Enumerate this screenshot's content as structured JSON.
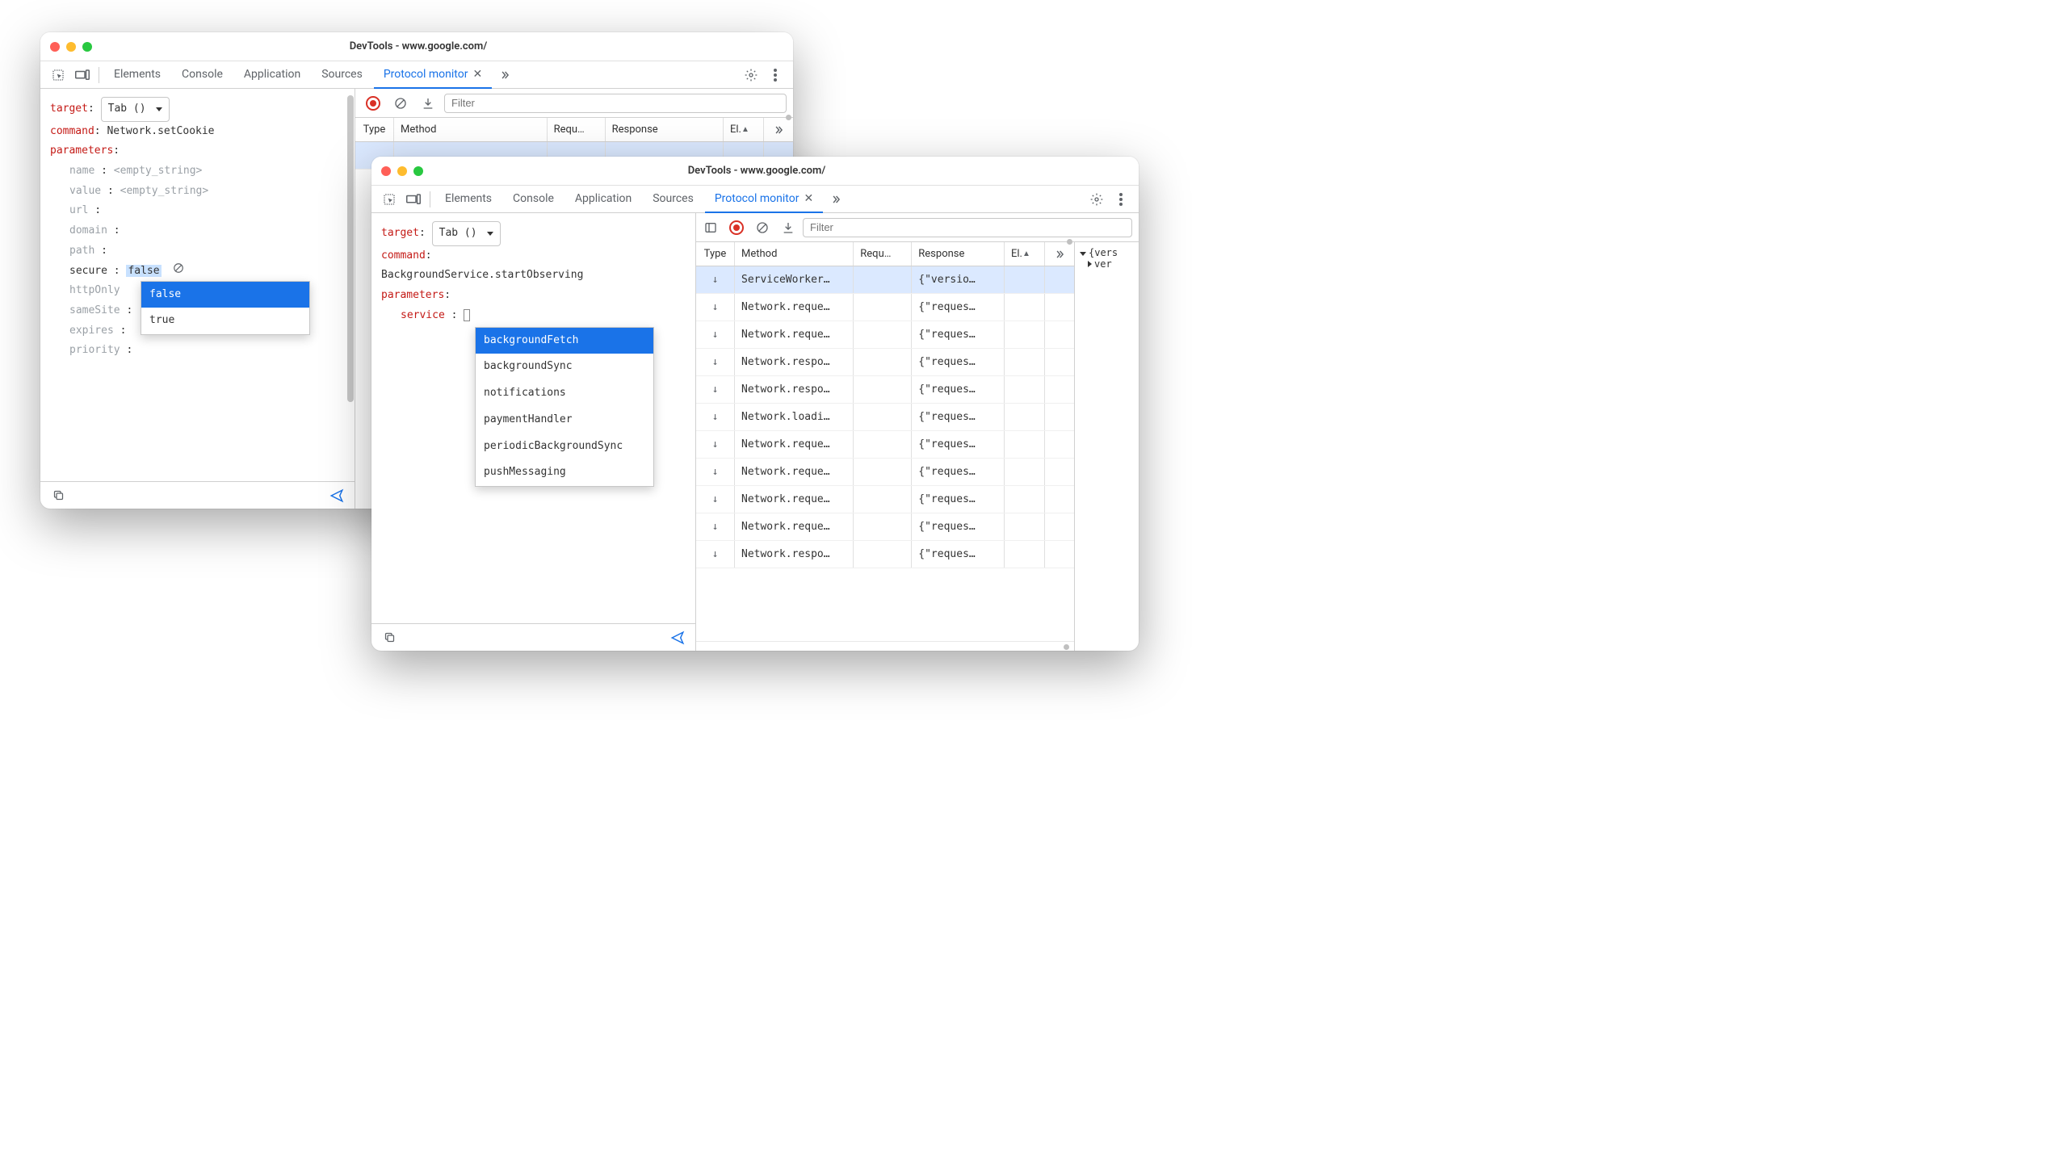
{
  "window1": {
    "title": "DevTools - www.google.com/",
    "tabs": [
      "Elements",
      "Console",
      "Application",
      "Sources",
      "Protocol monitor"
    ],
    "active_tab": "Protocol monitor",
    "target_label": "target",
    "target_select": "Tab ()",
    "command_label": "command",
    "command_value": "Network.setCookie",
    "parameters_label": "parameters",
    "params": {
      "name": {
        "k": "name",
        "v": "<empty_string>"
      },
      "value": {
        "k": "value",
        "v": "<empty_string>"
      },
      "url": {
        "k": "url",
        "v": ""
      },
      "domain": {
        "k": "domain",
        "v": ""
      },
      "path": {
        "k": "path",
        "v": ""
      },
      "secure": {
        "k": "secure",
        "v": "false"
      },
      "httpOnly": {
        "k": "httpOnly",
        "v": ""
      },
      "sameSite": {
        "k": "sameSite",
        "v": ""
      },
      "expires": {
        "k": "expires",
        "v": ""
      },
      "priority": {
        "k": "priority",
        "v": ""
      }
    },
    "bool_dropdown": [
      "false",
      "true"
    ],
    "right_cols": {
      "type": "Type",
      "method": "Method",
      "req": "Requ…",
      "resp": "Response",
      "el": "El.",
      "sort": "▲"
    },
    "filter_placeholder": "Filter"
  },
  "window2": {
    "title": "DevTools - www.google.com/",
    "tabs": [
      "Elements",
      "Console",
      "Application",
      "Sources",
      "Protocol monitor"
    ],
    "active_tab": "Protocol monitor",
    "target_label": "target",
    "target_select": "Tab ()",
    "command_label": "command",
    "command_value": "BackgroundService.startObserving",
    "parameters_label": "parameters",
    "service_label": "service",
    "service_dropdown": [
      "backgroundFetch",
      "backgroundSync",
      "notifications",
      "paymentHandler",
      "periodicBackgroundSync",
      "pushMessaging"
    ],
    "filter_placeholder": "Filter",
    "right_cols": {
      "type": "Type",
      "method": "Method",
      "req": "Requ…",
      "resp": "Response",
      "el": "El.",
      "sort": "▲"
    },
    "rows": [
      {
        "method": "ServiceWorker…",
        "resp": "{\"versio…"
      },
      {
        "method": "Network.reque…",
        "resp": "{\"reques…"
      },
      {
        "method": "Network.reque…",
        "resp": "{\"reques…"
      },
      {
        "method": "Network.respo…",
        "resp": "{\"reques…"
      },
      {
        "method": "Network.respo…",
        "resp": "{\"reques…"
      },
      {
        "method": "Network.loadi…",
        "resp": "{\"reques…"
      },
      {
        "method": "Network.reque…",
        "resp": "{\"reques…"
      },
      {
        "method": "Network.reque…",
        "resp": "{\"reques…"
      },
      {
        "method": "Network.reque…",
        "resp": "{\"reques…"
      },
      {
        "method": "Network.reque…",
        "resp": "{\"reques…"
      },
      {
        "method": "Network.respo…",
        "resp": "{\"reques…"
      }
    ],
    "side_json": {
      "root": "{vers",
      "child": "ver"
    }
  }
}
